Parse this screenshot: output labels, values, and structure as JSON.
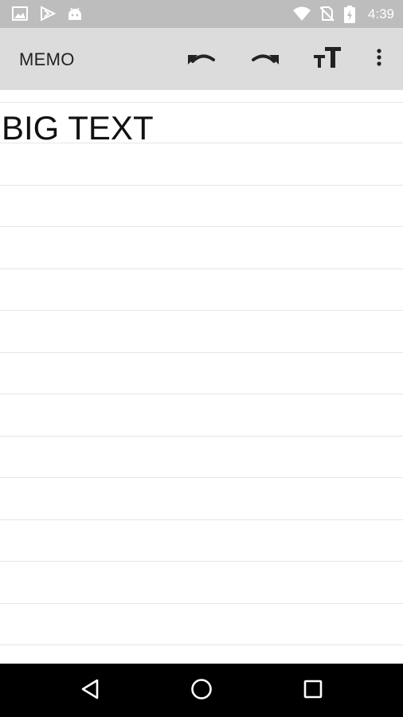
{
  "status_bar": {
    "time": "4:39",
    "icons": [
      "image-icon",
      "play-store-icon",
      "android-icon",
      "wifi-icon",
      "no-sim-icon",
      "battery-charging-icon"
    ]
  },
  "app_bar": {
    "title": "MEMO",
    "actions": [
      "undo-icon",
      "redo-icon",
      "text-size-icon",
      "more-vert-icon"
    ]
  },
  "memo": {
    "text": "BIG TEXT"
  },
  "nav_bar": {
    "buttons": [
      "back-icon",
      "home-icon",
      "recents-icon"
    ]
  },
  "colors": {
    "status_bar": "#bdbdbd",
    "app_bar": "#dcdcdc",
    "memo_line": "#e6e6e6",
    "nav_bar": "#000000"
  }
}
